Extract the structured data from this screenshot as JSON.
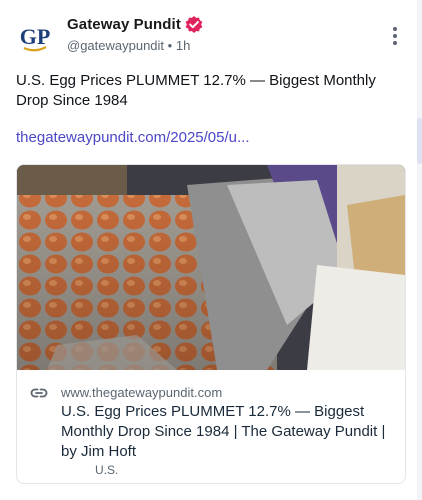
{
  "author": {
    "name": "Gateway Pundit",
    "handle": "@gatewaypundit",
    "separator": "•",
    "time": "1h",
    "avatar_text": "GP",
    "verified_color": "#e0245e",
    "avatar_color": "#1c3f7c"
  },
  "post": {
    "text": "U.S. Egg Prices PLUMMET 12.7% — Biggest Monthly Drop Since 1984",
    "link_text": "thegatewaypundit.com/2025/05/u...",
    "link_color": "#4b47c7"
  },
  "card": {
    "domain": "www.thegatewaypundit.com",
    "title": "U.S. Egg Prices PLUMMET 12.7% — Biggest Monthly Drop Since 1984 | The Gateway Pundit | by Jim Hoft",
    "description": "U.S."
  },
  "icons": {
    "verified": "verified-badge-icon",
    "more": "more-options-vertical-icon",
    "link": "link-chain-icon"
  }
}
